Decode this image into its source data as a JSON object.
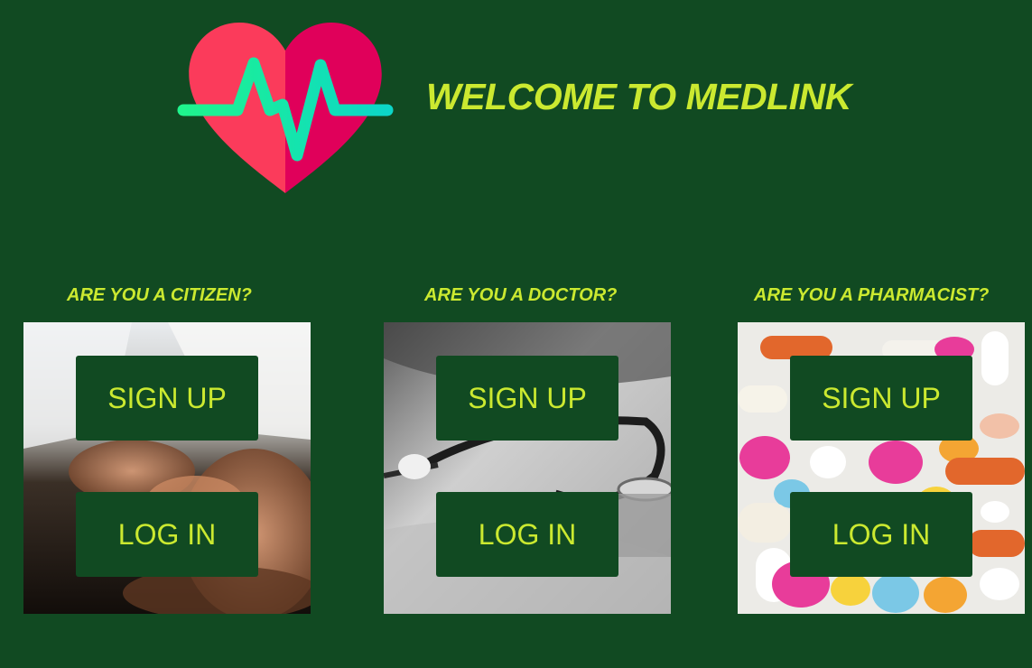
{
  "header": {
    "title": "WELCOME TO MEDLINK",
    "logo_icon": "heart-pulse-icon"
  },
  "roles": [
    {
      "heading": "ARE YOU A CITIZEN?",
      "image": "holding-hands-photo",
      "signup_label": "SIGN UP",
      "login_label": "LOG IN"
    },
    {
      "heading": "ARE YOU A DOCTOR?",
      "image": "stethoscope-photo",
      "signup_label": "SIGN UP",
      "login_label": "LOG IN"
    },
    {
      "heading": "ARE YOU A PHARMACIST?",
      "image": "pills-photo",
      "signup_label": "SIGN UP",
      "login_label": "LOG IN"
    }
  ],
  "colors": {
    "background": "#114a22",
    "accent": "#cbe930",
    "heart_left": "#fb3b5b",
    "heart_right": "#e0005a",
    "pulse_line": "#16e3a8"
  }
}
